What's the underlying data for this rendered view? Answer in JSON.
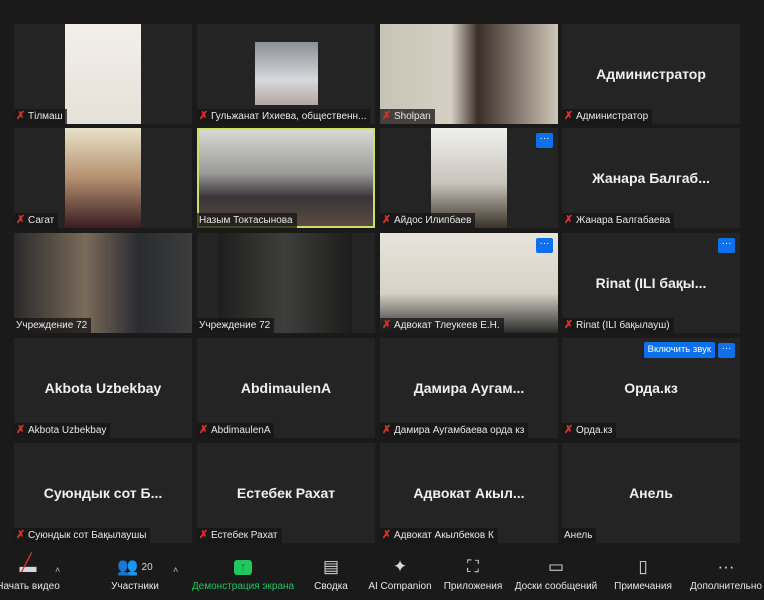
{
  "tiles": [
    {
      "display_name": "Тілмаш",
      "label": "Тілмаш",
      "muted": true,
      "has_video": true
    },
    {
      "display_name": "Гульжанат Ихиева, общественн...",
      "label": "Гульжанат Ихиева, общественн...",
      "muted": true,
      "has_video": true
    },
    {
      "display_name": "Sholpan",
      "label": "Sholpan",
      "muted": true,
      "has_video": true
    },
    {
      "display_name": "Администратор",
      "label": "Администратор",
      "muted": true,
      "has_video": false
    },
    {
      "display_name": "Сагат",
      "label": "Сагат",
      "muted": true,
      "has_video": true
    },
    {
      "display_name": "Назым Токтасынова",
      "label": "Назым Токтасынова",
      "muted": false,
      "has_video": true,
      "active_speaker": true
    },
    {
      "display_name": "Айдос Илипбаев",
      "label": "Айдос Илипбаев",
      "muted": true,
      "has_video": true,
      "more_button": "···"
    },
    {
      "display_name": "Жанара  Балгаб...",
      "label": "Жанара Балгабаева",
      "muted": true,
      "has_video": false
    },
    {
      "display_name": "Учреждение 72",
      "label": "Учреждение 72",
      "muted": false,
      "has_video": true
    },
    {
      "display_name": "Учреждение 72",
      "label": "Учреждение 72",
      "muted": false,
      "has_video": true
    },
    {
      "display_name": "Адвокат Тлеукеев Е.Н.",
      "label": "Адвокат Тлеукеев Е.Н.",
      "muted": true,
      "has_video": true,
      "more_button": "···"
    },
    {
      "display_name": "Rinat (ILI бақы...",
      "label": "Rinat (ILI бақылауш)",
      "muted": true,
      "has_video": false,
      "more_button": "···"
    },
    {
      "display_name": "Akbota Uzbekbay",
      "label": "Akbota Uzbekbay",
      "muted": true,
      "has_video": false
    },
    {
      "display_name": "AbdimaulenA",
      "label": "AbdimaulenA",
      "muted": true,
      "has_video": false
    },
    {
      "display_name": "Дамира  Аугам...",
      "label": "Дамира Аугамбаева орда кз",
      "muted": true,
      "has_video": false
    },
    {
      "display_name": "Орда.кз",
      "label": "Орда.кз",
      "muted": true,
      "has_video": false,
      "more_button": "···",
      "unmute_button": "Включить звук"
    },
    {
      "display_name": "Суюндык сот Б...",
      "label": "Суюндык сот Бақылаушы",
      "muted": true,
      "has_video": false
    },
    {
      "display_name": "Естебек Рахат",
      "label": "Естебек Рахат",
      "muted": true,
      "has_video": false
    },
    {
      "display_name": "Адвокат  Акыл...",
      "label": "Адвокат Акылбеков К",
      "muted": true,
      "has_video": false
    },
    {
      "display_name": "Анель",
      "label": "Анель",
      "muted": false,
      "has_video": false
    }
  ],
  "toolbar": {
    "video": {
      "label": "Начать видео",
      "icon": "video-off-icon"
    },
    "participants": {
      "label": "Участники",
      "count": "20",
      "icon": "participants-icon"
    },
    "share": {
      "label": "Демонстрация экрана",
      "icon": "share-screen-icon",
      "color": "#22c55e"
    },
    "summary": {
      "label": "Сводка",
      "icon": "summary-icon"
    },
    "ai": {
      "label": "AI Companion",
      "icon": "sparkle-icon"
    },
    "apps": {
      "label": "Приложения",
      "icon": "apps-icon"
    },
    "whiteboards": {
      "label": "Доски сообщений",
      "icon": "whiteboard-icon"
    },
    "notes": {
      "label": "Примечания",
      "icon": "notes-icon"
    },
    "more": {
      "label": "Дополнительно",
      "icon": "more-icon",
      "glyph": "···"
    },
    "caret": "˄"
  },
  "colors": {
    "accent": "#0e71eb",
    "active_speaker": "#c9e265",
    "muted": "#e0302c"
  }
}
